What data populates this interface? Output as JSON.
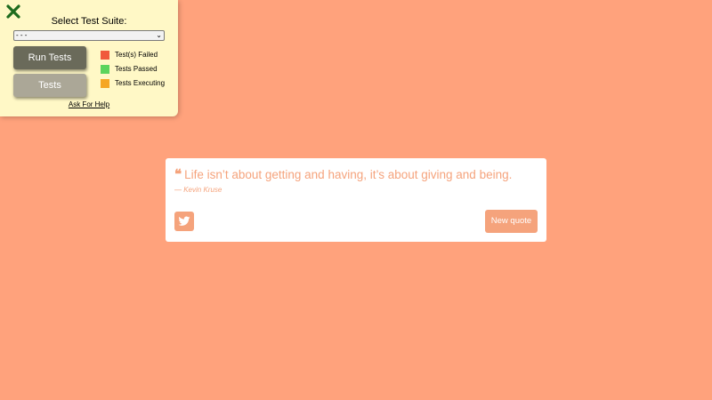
{
  "test_panel": {
    "title": "Select Test Suite:",
    "suite_select_value": "- - -",
    "run_button_label": "Run Tests",
    "tests_button_label": "Tests",
    "legend": [
      {
        "label": "Test(s) Failed",
        "color": "#f05a3c"
      },
      {
        "label": "Tests Passed",
        "color": "#5cd45c"
      },
      {
        "label": "Tests Executing",
        "color": "#f5a623"
      }
    ],
    "help_link": "Ask For Help",
    "close_icon_color": "#1e6b1e"
  },
  "quote": {
    "text": "Life isn’t about getting and having, it’s about giving and being.",
    "author": "— Kevin Kruse",
    "quote_mark": "❝",
    "new_quote_label": "New quote",
    "accent_color": "#f5a37c",
    "tweet_icon": "twitter-icon"
  },
  "colors": {
    "page_background": "#ffa27c",
    "panel_background": "#fff8c6"
  }
}
